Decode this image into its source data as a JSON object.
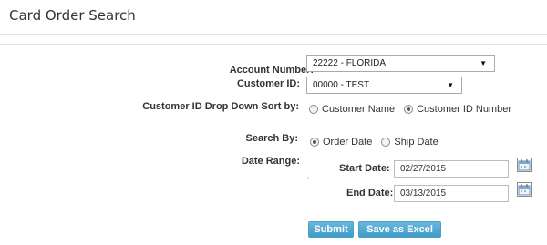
{
  "page": {
    "title": "Card Order Search"
  },
  "form": {
    "account_number_label": "Account Number:",
    "account_number_value": "22222 - FLORIDA",
    "customer_id_label": "Customer ID:",
    "customer_id_value": "00000 - TEST",
    "sort_label": "Customer ID Drop Down Sort by:",
    "sort_options": [
      {
        "label": "Customer Name",
        "selected": false
      },
      {
        "label": "Customer ID Number",
        "selected": true
      }
    ],
    "search_by_label": "Search By:",
    "search_by_options": [
      {
        "label": "Order Date",
        "selected": true
      },
      {
        "label": "Ship Date",
        "selected": false
      }
    ],
    "date_range_label": "Date Range:",
    "start_date_label": "Start Date:",
    "start_date_value": "02/27/2015",
    "end_date_label": "End Date:",
    "end_date_value": "03/13/2015"
  },
  "actions": {
    "submit_label": "Submit",
    "excel_label": "Save as Excel"
  },
  "icons": {
    "dropdown": "chevron-down-icon",
    "calendar": "calendar-icon"
  },
  "colors": {
    "button_bg": "#4aa5d0",
    "button_border": "#4c9fc5",
    "rule": "#e4e4e4"
  }
}
